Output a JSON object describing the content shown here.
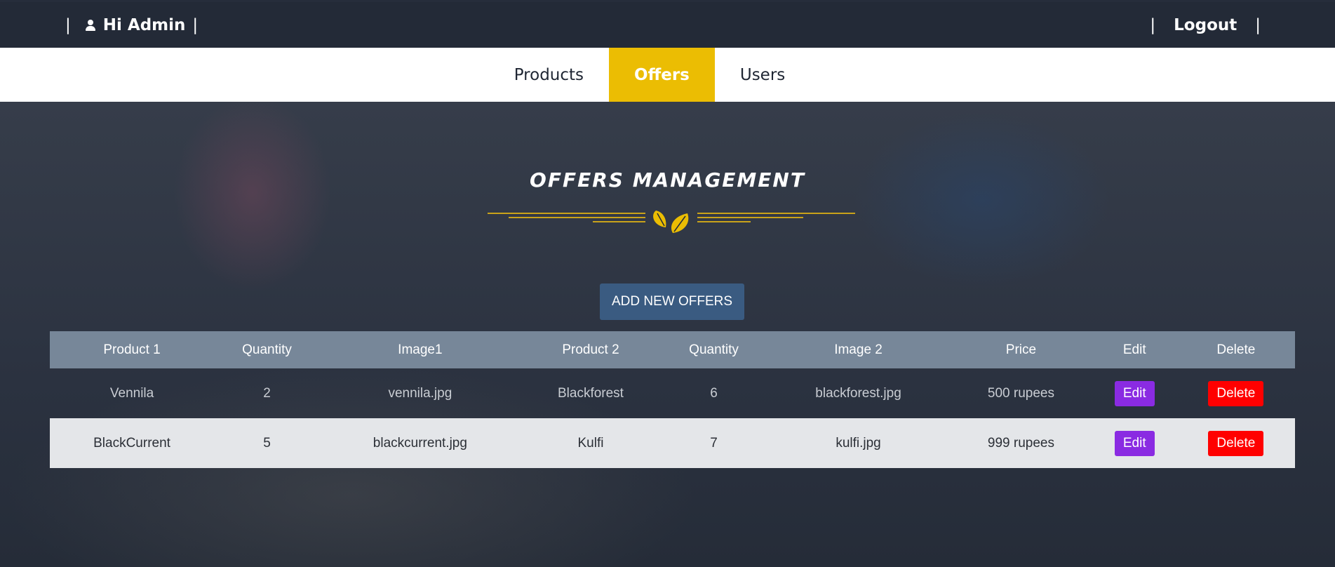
{
  "header": {
    "greeting": "Hi Admin",
    "sep_left": "|",
    "sep_mid": "|",
    "sep_right_1": "|",
    "sep_right_2": "|",
    "logout": "Logout"
  },
  "nav": {
    "items": [
      {
        "label": "Products"
      },
      {
        "label": "Offers",
        "active": true
      },
      {
        "label": "Users"
      }
    ],
    "active_color": "#ebbd03"
  },
  "page": {
    "title": "OFFERS MANAGEMENT",
    "add_button": "ADD NEW OFFERS"
  },
  "table": {
    "headers": [
      "Product 1",
      "Quantity",
      "Image1",
      "Product 2",
      "Quantity",
      "Image 2",
      "Price",
      "Edit",
      "Delete"
    ],
    "rows": [
      {
        "product1": "Vennila",
        "qty1": "2",
        "image1": "vennila.jpg",
        "product2": "Blackforest",
        "qty2": "6",
        "image2": "blackforest.jpg",
        "price": "500 rupees",
        "edit": "Edit",
        "delete": "Delete"
      },
      {
        "product1": "BlackCurrent",
        "qty1": "5",
        "image1": "blackcurrent.jpg",
        "product2": "Kulfi",
        "qty2": "7",
        "image2": "kulfi.jpg",
        "price": "999 rupees",
        "edit": "Edit",
        "delete": "Delete"
      }
    ]
  },
  "colors": {
    "topbar": "#232a37",
    "add_button": "#3a5b81",
    "edit_button": "#8a2be2",
    "delete_button": "#ff0000",
    "table_header": "#778799"
  },
  "icons": {
    "user": "user-icon",
    "divider": "leaf-icon"
  }
}
